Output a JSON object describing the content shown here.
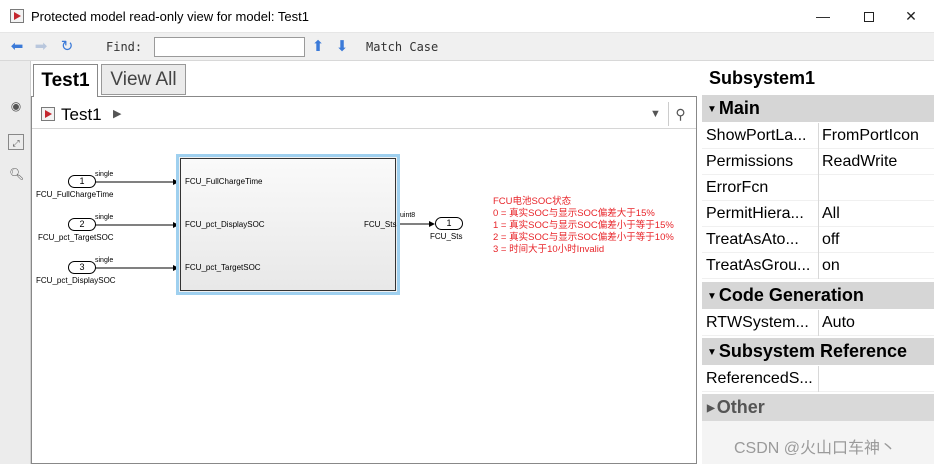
{
  "window": {
    "title": "Protected model read-only view for model: Test1",
    "minimize": "—",
    "close": "✕"
  },
  "toolbar": {
    "find_label": "Find:",
    "find_value": "",
    "match_case_label": "Match Case"
  },
  "tabs": [
    {
      "label": "Test1",
      "active": true
    },
    {
      "label": "View All",
      "active": false
    }
  ],
  "breadcrumb": {
    "path": "Test1"
  },
  "diagram": {
    "inports": [
      {
        "number": "1",
        "name": "FCU_FullChargeTime",
        "signal_type": "single"
      },
      {
        "number": "2",
        "name": "FCU_pct_TargetSOC",
        "signal_type": "single"
      },
      {
        "number": "3",
        "name": "FCU_pct_DisplaySOC",
        "signal_type": "single"
      }
    ],
    "subsystem": {
      "input_ports": [
        "FCU_FullChargeTime",
        "FCU_pct_DisplaySOC",
        "FCU_pct_TargetSOC"
      ],
      "output_port": "FCU_Sts"
    },
    "outport": {
      "number": "1",
      "name": "FCU_Sts",
      "signal_type": "uint8"
    },
    "annotation": [
      "FCU电池SOC状态",
      "0 = 真实SOC与显示SOC偏差大于15%",
      "1 = 真实SOC与显示SOC偏差小于等于15%",
      "2 = 真实SOC与显示SOC偏差小于等于10%",
      "3 = 时间大于10小时Invalid"
    ],
    "annotation_color": "#e8252a",
    "selection_color": "#9fd0ef"
  },
  "properties": {
    "title": "Subsystem1",
    "sections": [
      {
        "name": "Main",
        "expanded": true,
        "rows": [
          {
            "name": "ShowPortLa...",
            "value": "FromPortIcon"
          },
          {
            "name": "Permissions",
            "value": "ReadWrite"
          },
          {
            "name": "ErrorFcn",
            "value": ""
          },
          {
            "name": "PermitHiera...",
            "value": "All"
          },
          {
            "name": "TreatAsAto...",
            "value": "off"
          },
          {
            "name": "TreatAsGrou...",
            "value": "on"
          }
        ]
      },
      {
        "name": "Code Generation",
        "expanded": true,
        "rows": [
          {
            "name": "RTWSystem...",
            "value": "Auto"
          }
        ]
      },
      {
        "name": "Subsystem Reference",
        "expanded": true,
        "rows": [
          {
            "name": "ReferencedS...",
            "value": ""
          }
        ]
      },
      {
        "name": "Other",
        "expanded": false,
        "rows": []
      }
    ]
  },
  "watermark": "CSDN @火山口车神丶"
}
